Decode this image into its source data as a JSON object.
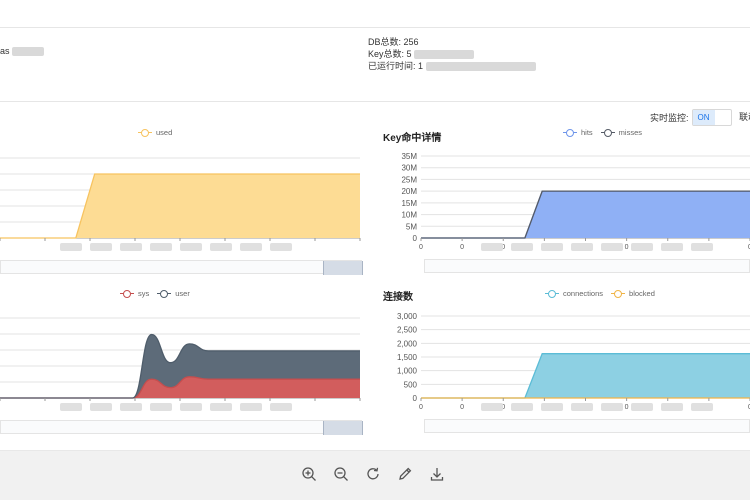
{
  "info": {
    "left_partial": "as",
    "db_label": "DB总数:",
    "db_value": "256",
    "key_label": "Key总数:",
    "key_value_partial": "5",
    "uptime_label": "已运行时间:",
    "uptime_value_partial": "1"
  },
  "controls": {
    "monitor_label": "实时监控:",
    "monitor_state": "ON",
    "extra_label": "联动"
  },
  "toolbar": {
    "icons": [
      "zoom-in-icon",
      "zoom-out-icon",
      "refresh-icon",
      "edit-icon",
      "download-icon"
    ]
  },
  "chart_data": [
    {
      "type": "area",
      "title": "",
      "legend": [
        "used"
      ],
      "series": [
        {
          "name": "used",
          "color": "#f7c35f",
          "fill": "#fddc94",
          "values": [
            0,
            0,
            0,
            0,
            0,
            1,
            1,
            1,
            1,
            1,
            1,
            1,
            1,
            1,
            1,
            1,
            1,
            1,
            1,
            1
          ]
        }
      ],
      "grid": true
    },
    {
      "type": "area",
      "title": "Key命中详情",
      "legend": [
        "hits",
        "misses"
      ],
      "y_ticks": [
        "35M",
        "30M",
        "25M",
        "20M",
        "15M",
        "10M",
        "5M",
        "0"
      ],
      "ylim": [
        0,
        35000000
      ],
      "x_ticks": [
        "0",
        "0",
        "0",
        "0",
        "0",
        "0",
        "0",
        "0",
        "0"
      ],
      "series": [
        {
          "name": "hits",
          "color": "#6e95ea",
          "fill": "#8fb0f5",
          "values": [
            0,
            0,
            0,
            0,
            0,
            0,
            0,
            20000000,
            20000000,
            20000000,
            20000000,
            20000000,
            20000000,
            20000000,
            20000000,
            20000000,
            20000000,
            20000000,
            20000000,
            20000000
          ]
        },
        {
          "name": "misses",
          "color": "#555b66",
          "fill": "none",
          "values": [
            0,
            0,
            0,
            0,
            0,
            0,
            0,
            20000000,
            20000000,
            20000000,
            20000000,
            20000000,
            20000000,
            20000000,
            20000000,
            20000000,
            20000000,
            20000000,
            20000000,
            20000000
          ]
        }
      ],
      "grid": true
    },
    {
      "type": "area",
      "title": "",
      "legend": [
        "sys",
        "user"
      ],
      "series": [
        {
          "name": "sys",
          "color": "#c44e4e",
          "fill": "#d25d5d",
          "values": [
            0,
            0,
            0,
            0,
            0,
            0,
            0,
            0,
            0.4,
            0.22,
            0.45,
            0.4,
            0.4,
            0.4,
            0.4,
            0.4,
            0.4,
            0.4,
            0.4,
            0.4
          ]
        },
        {
          "name": "user",
          "color": "#4f5d6b",
          "fill": "#5d6b79",
          "values": [
            0,
            0,
            0,
            0,
            0,
            0,
            0,
            0,
            1.35,
            0.75,
            1.15,
            1.0,
            1.0,
            1.0,
            1.0,
            1.0,
            1.0,
            1.0,
            1.0,
            1.0
          ]
        }
      ],
      "grid": true
    },
    {
      "type": "area",
      "title": "连接数",
      "legend": [
        "connections",
        "blocked"
      ],
      "y_ticks": [
        "3,000",
        "2,500",
        "2,000",
        "1,500",
        "1,000",
        "500",
        "0"
      ],
      "ylim": [
        0,
        3000
      ],
      "x_ticks": [
        "0",
        "0",
        "0",
        "0",
        "0",
        "0",
        "0",
        "0",
        "0"
      ],
      "series": [
        {
          "name": "connections",
          "color": "#5bbcd6",
          "fill": "#8dd0e3",
          "values": [
            0,
            0,
            0,
            0,
            0,
            0,
            0,
            1620,
            1620,
            1620,
            1620,
            1620,
            1620,
            1620,
            1620,
            1620,
            1620,
            1620,
            1620,
            1620
          ]
        },
        {
          "name": "blocked",
          "color": "#f0b447",
          "fill": "none",
          "values": [
            0,
            0,
            0,
            0,
            0,
            0,
            0,
            0,
            0,
            0,
            0,
            0,
            0,
            0,
            0,
            0,
            0,
            0,
            0,
            0
          ]
        }
      ],
      "grid": true
    }
  ]
}
